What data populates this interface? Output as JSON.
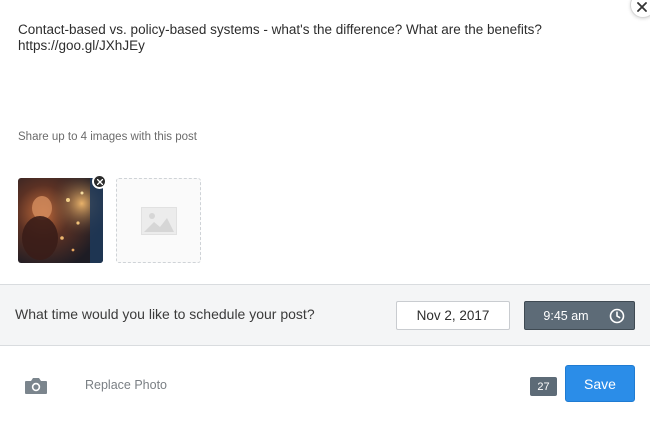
{
  "composer": {
    "post_text": "Contact-based vs. policy-based systems - what's the difference? What are the benefits?\nhttps://goo.gl/JXhJEy"
  },
  "images": {
    "hint": "Share up to 4 images with this post",
    "attached": [
      {
        "icon": "photo-thumbnail"
      }
    ],
    "add_slot_icon": "image-placeholder-icon"
  },
  "schedule": {
    "question": "What time would you like to schedule your post?",
    "date": "Nov 2, 2017",
    "time": "9:45 am",
    "time_icon": "clock-icon"
  },
  "footer": {
    "camera_icon": "camera-icon",
    "replace_photo_label": "Replace Photo",
    "char_count": "27",
    "save_label": "Save"
  },
  "colors": {
    "accent": "#2b8de8",
    "time_bg": "#5d6b77",
    "bar_bg": "#f4f5f6"
  }
}
